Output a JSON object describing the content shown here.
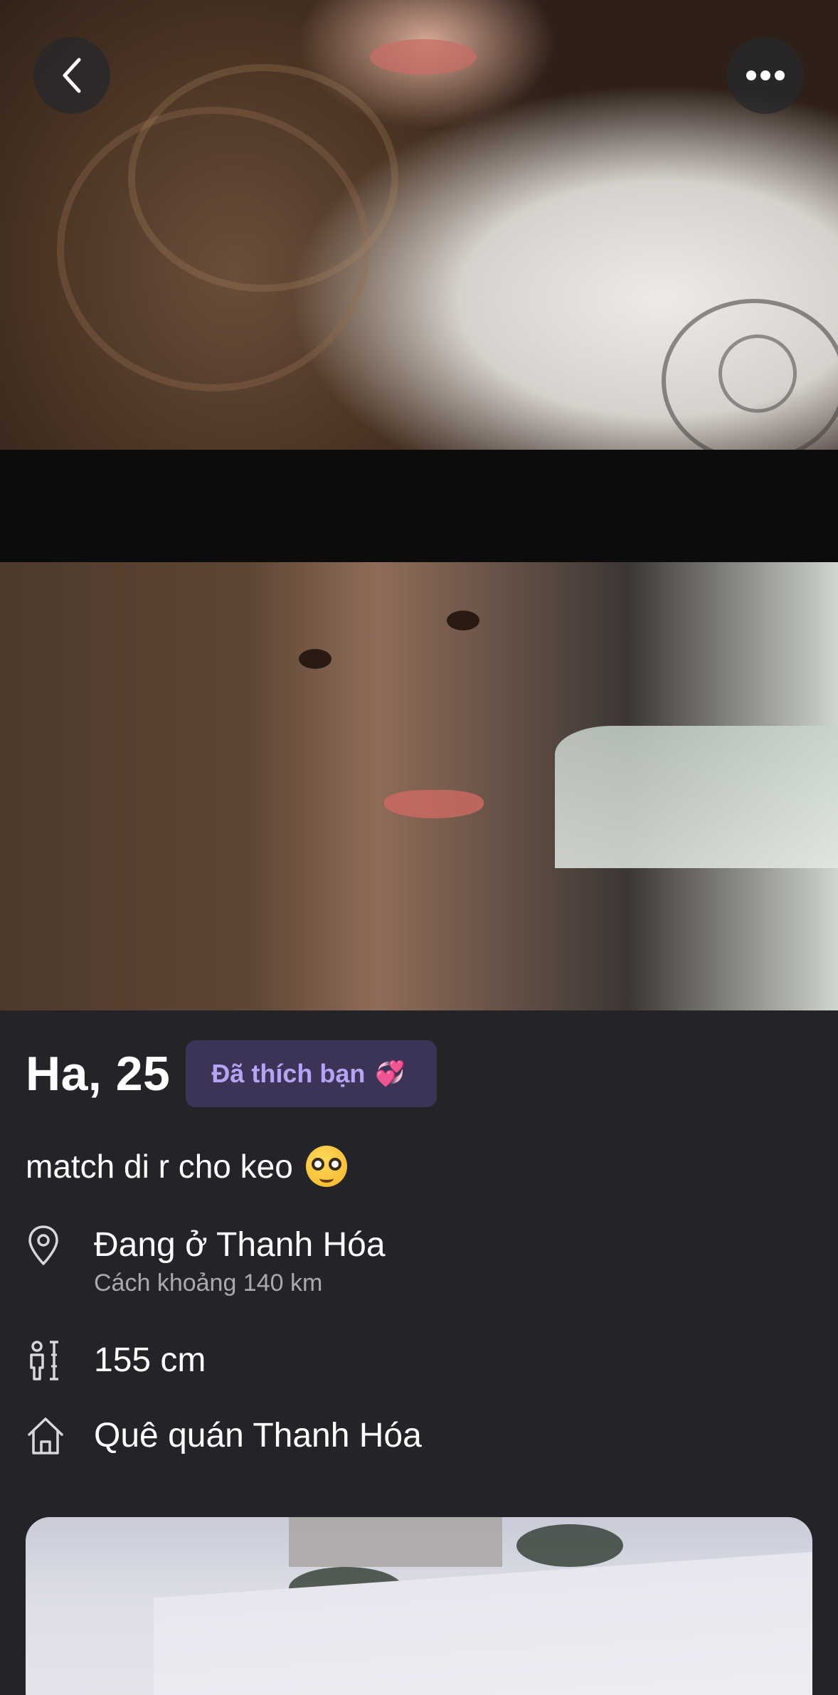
{
  "header": {
    "back_button_label": "Back",
    "more_button_label": "More options"
  },
  "profile": {
    "name_age": "Ha, 25",
    "liked_badge": "Đã thích bạn",
    "liked_badge_emoji": "💞",
    "bio": "match di r cho keo",
    "bio_emoji": "nerd-face-emoji"
  },
  "details": {
    "location": {
      "icon": "location-pin-icon",
      "text": "Đang ở Thanh Hóa",
      "distance": "Cách  khoảng 140 km"
    },
    "height": {
      "icon": "height-icon",
      "text": "155 cm"
    },
    "hometown": {
      "icon": "home-icon",
      "text": "Quê quán Thanh Hóa"
    }
  },
  "colors": {
    "background": "#242428",
    "badge_bg": "#3b3457",
    "badge_text": "#b7a3f2",
    "secondary_text": "#a9a9b0"
  }
}
